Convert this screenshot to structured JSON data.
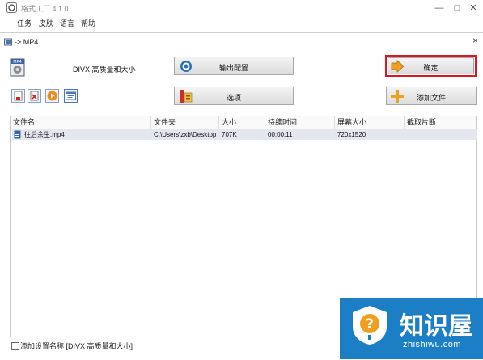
{
  "app": {
    "title": "格式工厂 4.1.0",
    "menu": [
      "任务",
      "皮肤",
      "语言",
      "帮助"
    ],
    "controls": {
      "minimize": "—",
      "maximize": "□",
      "close": "✕"
    }
  },
  "dialog": {
    "title": "-> MP4",
    "close": "×",
    "profile_label": "DIVX 高质量和大小",
    "buttons": {
      "output_config": "输出配置",
      "options": "选项",
      "ok": "确定",
      "add_file": "添加文件"
    },
    "ok_highlight_color": "#e0161e",
    "table": {
      "headers": [
        "文件名",
        "文件夹",
        "大小",
        "持续时间",
        "屏幕大小",
        "截取片断"
      ],
      "rows": [
        [
          "往后余生.mp4",
          "C:\\Users\\zxb\\Desktop",
          "707K",
          "00:00:11",
          "720x1520",
          ""
        ]
      ]
    },
    "footer_checkbox_label": "添加设置名称 [DIVX 高质量和大小]"
  },
  "watermark": {
    "brand": "知识屋",
    "url": "zhishiwu.com",
    "color": "#1c7fc6"
  }
}
